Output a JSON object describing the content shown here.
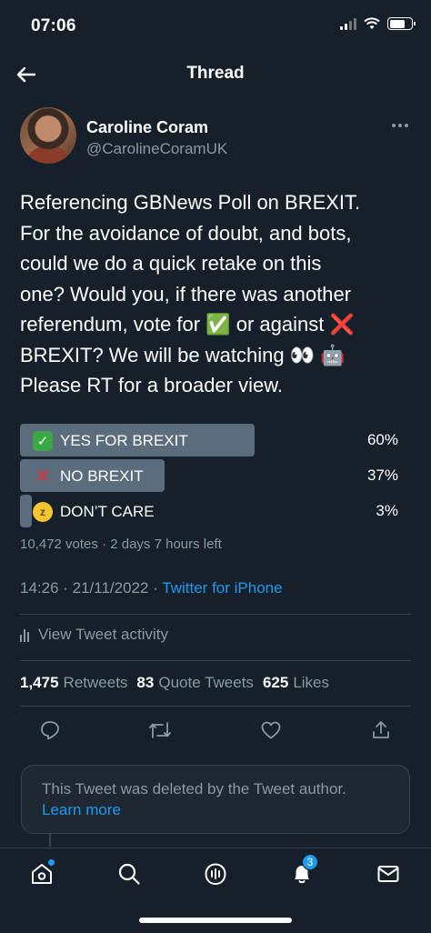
{
  "status_bar": {
    "time": "07:06"
  },
  "header": {
    "title": "Thread"
  },
  "author": {
    "name": "Caroline Coram",
    "handle": "@CarolineCoramUK"
  },
  "tweet": {
    "lines": [
      "Referencing GBNews Poll on BREXIT.",
      "For the avoidance of doubt, and bots,",
      "could we do a quick retake on this",
      "one? Would you, if there was another",
      "referendum, vote for ✅ or against ❌",
      "BREXIT? We will be watching 👀 🤖",
      "Please RT for a broader view."
    ]
  },
  "poll": {
    "options": [
      {
        "label": "YES FOR BREXIT",
        "percent_label": "60%",
        "fraction": 0.6,
        "emoji": "✓"
      },
      {
        "label": "NO BREXIT",
        "percent_label": "37%",
        "fraction": 0.37,
        "emoji": "✕"
      },
      {
        "label": "DON’T CARE",
        "percent_label": "3%",
        "fraction": 0.03,
        "emoji": "z"
      }
    ],
    "meta": "10,472 votes · 2 days 7 hours left"
  },
  "timestamp": {
    "when": "14:26 · 21/11/2022 · ",
    "source": "Twitter for iPhone"
  },
  "activity": {
    "label": "View Tweet activity"
  },
  "stats": {
    "retweets_count": "1,475",
    "retweets_label": "Retweets",
    "quotes_count": "83",
    "quotes_label": "Quote Tweets",
    "likes_count": "625",
    "likes_label": "Likes"
  },
  "deleted": {
    "text": "This Tweet was deleted by the Tweet author.",
    "link": "Learn more"
  },
  "tabbar": {
    "notifications_badge": "3"
  },
  "colors": {
    "background": "#15202b",
    "accent": "#1d9bf0",
    "muted": "#8b98a5",
    "poll_bar": "#5b6d7c"
  }
}
